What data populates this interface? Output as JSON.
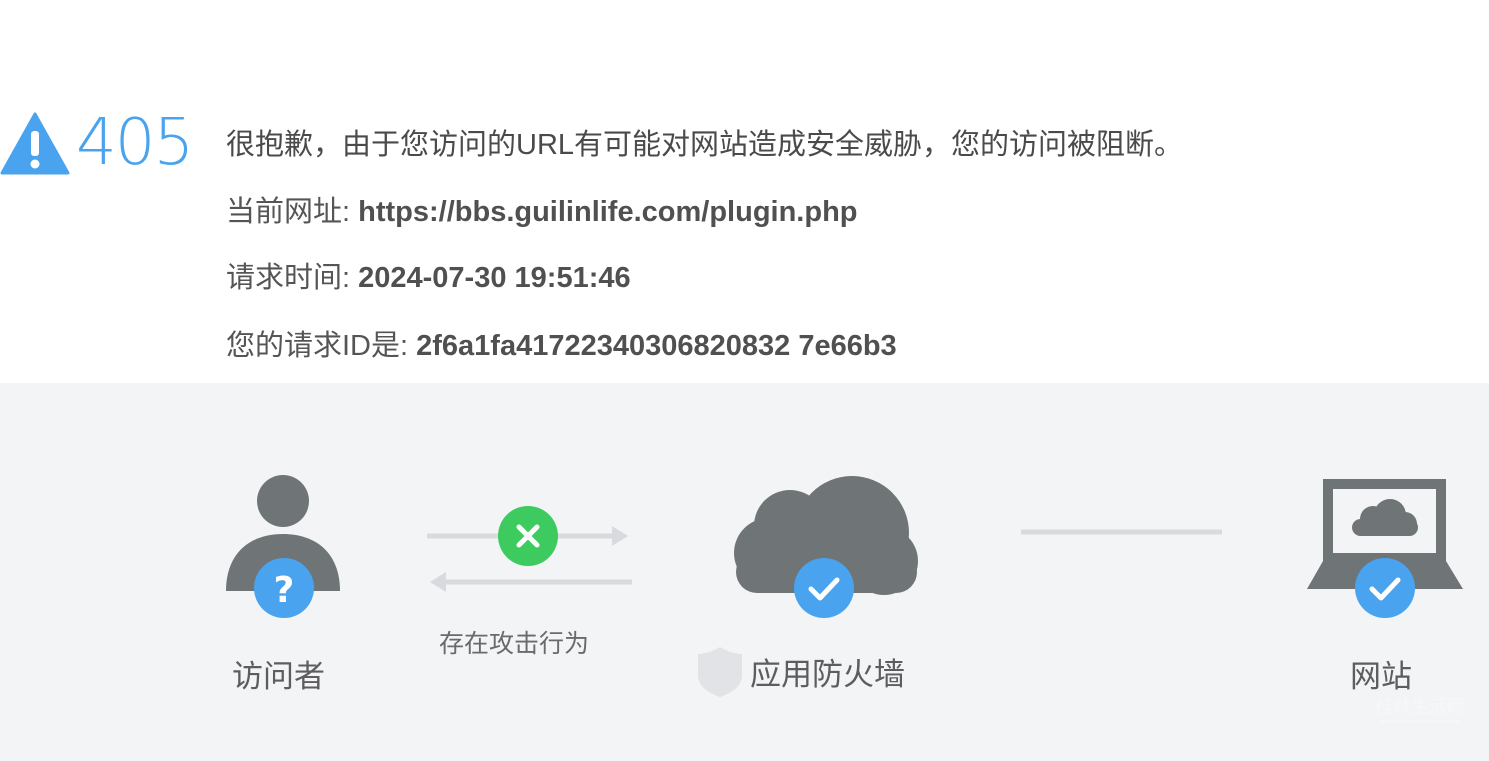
{
  "error": {
    "code": "405",
    "message": "很抱歉，由于您访问的URL有可能对网站造成安全威胁，您的访问被阻断。"
  },
  "details": {
    "url_label": "当前网址: ",
    "url_value": "https://bbs.guilinlife.com/plugin.php",
    "time_label": "请求时间: ",
    "time_value": "2024-07-30 19:51:46",
    "id_label": "您的请求ID是: ",
    "id_value": "2f6a1fa41722340306820832 7e66b3"
  },
  "diagram": {
    "visitor_label": "访问者",
    "attack_label": "存在攻击行为",
    "waf_label": "应用防火墙",
    "site_label": "网站",
    "visitor_badge": "?",
    "colors": {
      "accent_blue": "#4aa3ee",
      "block_green": "#3dcb5f",
      "icon_gray": "#6f7576",
      "line_gray": "#d8dadd",
      "panel_bg": "#f3f4f6"
    }
  },
  "watermark_text": "桂林生活网"
}
